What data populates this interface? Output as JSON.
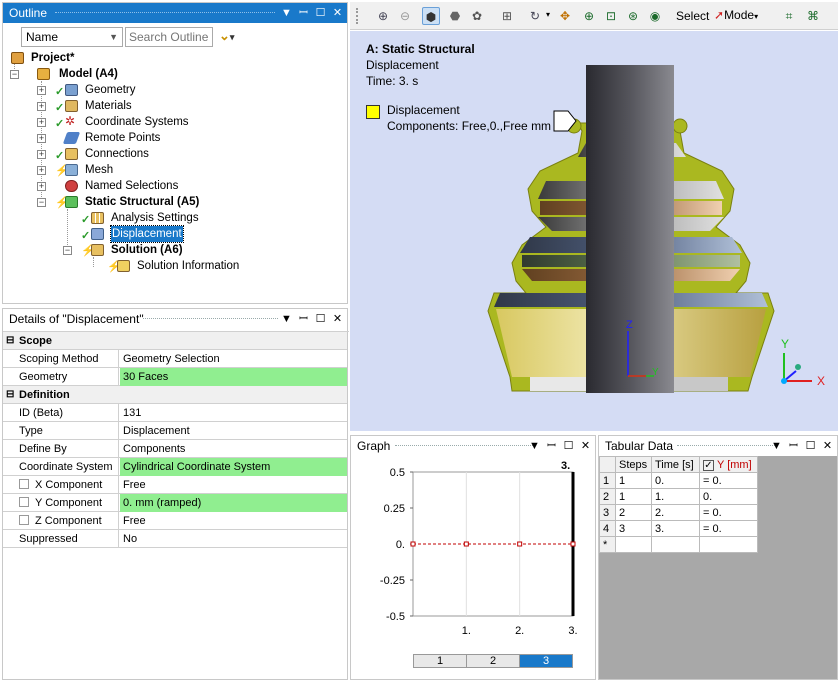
{
  "outline": {
    "title": "Outline",
    "filter_value": "Name",
    "search_placeholder": "Search Outline",
    "tree": [
      {
        "label": "Project*",
        "bold": true
      },
      {
        "label": "Model (A4)",
        "bold": true
      },
      {
        "label": "Geometry"
      },
      {
        "label": "Materials"
      },
      {
        "label": "Coordinate Systems"
      },
      {
        "label": "Remote Points"
      },
      {
        "label": "Connections"
      },
      {
        "label": "Mesh"
      },
      {
        "label": "Named Selections"
      },
      {
        "label": "Static Structural (A5)",
        "bold": true
      },
      {
        "label": "Analysis Settings"
      },
      {
        "label": "Displacement",
        "selected": true
      },
      {
        "label": "Solution (A6)",
        "bold": true
      },
      {
        "label": "Solution Information"
      }
    ]
  },
  "details": {
    "title": "Details of \"Displacement\"",
    "rows": [
      {
        "label": "Scope",
        "section": true
      },
      {
        "label": "Scoping Method",
        "value": "Geometry Selection"
      },
      {
        "label": "Geometry",
        "value": "30 Faces",
        "highlight": true
      },
      {
        "label": "Definition",
        "section": true
      },
      {
        "label": "ID (Beta)",
        "value": "131"
      },
      {
        "label": "Type",
        "value": "Displacement"
      },
      {
        "label": "Define By",
        "value": "Components"
      },
      {
        "label": "Coordinate System",
        "value": "Cylindrical Coordinate System",
        "highlight": true
      },
      {
        "label": "X Component",
        "value": "Free",
        "checkbox": true
      },
      {
        "label": "Y Component",
        "value": "0. mm  (ramped)",
        "checkbox": true,
        "highlight": true
      },
      {
        "label": "Z Component",
        "value": "Free",
        "checkbox": true
      },
      {
        "label": "Suppressed",
        "value": "No"
      }
    ]
  },
  "toolbar": {
    "select_label": "Select",
    "mode_label": "Mode"
  },
  "viewport": {
    "heading": "A: Static Structural",
    "line1": "Displacement",
    "line2": "Time: 3. s",
    "legend_title": "Displacement",
    "legend_sub": "Components: Free,0.,Free mm",
    "triad_y": "Y",
    "triad_x": "X",
    "local_z": "Z",
    "local_y": "Y"
  },
  "graph": {
    "title": "Graph",
    "marker": "3.",
    "tabs": [
      "1",
      "2",
      "3"
    ],
    "active_tab": "3"
  },
  "chart_data": {
    "type": "line",
    "x": [
      0,
      1,
      2,
      3
    ],
    "values": [
      0,
      0,
      0,
      0
    ],
    "xticks": [
      "1.",
      "2.",
      "3."
    ],
    "yticks": [
      "0.5",
      "0.25",
      "0.",
      "-0.25",
      "-0.5"
    ],
    "ylim": [
      -0.5,
      0.5
    ],
    "xlim": [
      0,
      3
    ],
    "grid": true,
    "color": "#c00000"
  },
  "tabular": {
    "title": "Tabular Data",
    "headers": [
      "Steps",
      "Time [s]",
      "Y [mm]"
    ],
    "rows": [
      {
        "n": "1",
        "step": "1",
        "time": "0.",
        "y": "= 0."
      },
      {
        "n": "2",
        "step": "1",
        "time": "1.",
        "y": "0."
      },
      {
        "n": "3",
        "step": "2",
        "time": "2.",
        "y": "= 0."
      },
      {
        "n": "4",
        "step": "3",
        "time": "3.",
        "y": "= 0."
      },
      {
        "n": "*",
        "step": "",
        "time": "",
        "y": ""
      }
    ]
  },
  "colors": {
    "title_blue": "#1979ca",
    "highlight": "#90ee90",
    "viewport_bg": "#d4dcf4",
    "selected_bg": "#1979ca"
  }
}
